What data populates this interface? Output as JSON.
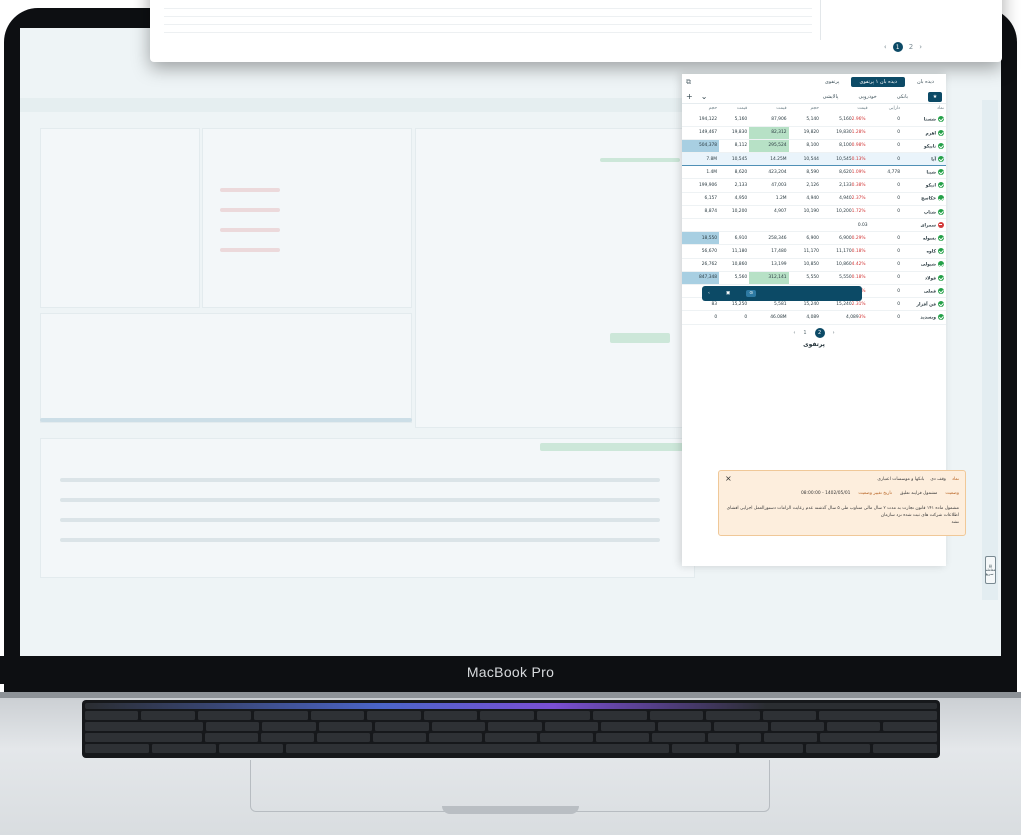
{
  "brand": "MacBook Pro",
  "tabs": [
    "دیده بان",
    "دیده بان ۱ پرتفوی",
    "پرتفوی"
  ],
  "subtabs": [
    "بانکی",
    "خودرویی",
    "پالایشی"
  ],
  "columns": [
    "نماد",
    "دارایی",
    "قیمت",
    "حجم",
    "قیمت",
    "قیمت",
    "حجم"
  ],
  "rows": [
    {
      "name": "شستا",
      "status": "green",
      "asset": "0",
      "price": "5,160",
      "change": "2.96%",
      "vol": "5,140",
      "bid": "87,906",
      "bid_price": "5,160",
      "bid_vol": "194,122"
    },
    {
      "name": "اهرم",
      "status": "green",
      "asset": "0",
      "price": "19,830",
      "change": "1.28%",
      "vol": "19,820",
      "bid": "82,312",
      "bid_price": "19,830",
      "bid_vol": "149,467"
    },
    {
      "name": "تاپیکو",
      "status": "green",
      "asset": "0",
      "price": "8,100",
      "change": "0.98%",
      "vol": "8,100",
      "bid": "295,524",
      "bid_price": "8,112",
      "bid_vol": "504,378"
    },
    {
      "name": "آبا",
      "status": "green",
      "asset": "0",
      "price": "10,545",
      "change": "0.13%",
      "vol": "10,544",
      "bid": "14.25M",
      "bid_price": "10,545",
      "bid_vol": "7.8M"
    },
    {
      "name": "شپنا",
      "status": "green",
      "asset": "4,778",
      "price": "8,620",
      "change": "1.09%",
      "vol": "8,590",
      "bid": "423,204",
      "bid_price": "8,620",
      "bid_vol": "1.4M"
    },
    {
      "name": "انیکو",
      "status": "green",
      "asset": "0",
      "price": "2,133",
      "change": "0.38%",
      "vol": "2,126",
      "bid": "47,003",
      "bid_price": "2,133",
      "bid_vol": "199,906"
    },
    {
      "name": "خکاسچ",
      "status": "green",
      "asset": "0",
      "price": "4,940",
      "change": "2.37%",
      "vol": "4,940",
      "bid": "1.2M",
      "bid_price": "4,950",
      "bid_vol": "6,157"
    },
    {
      "name": "شتاپ",
      "status": "green",
      "asset": "0",
      "price": "10,200",
      "change": "1.72%",
      "vol": "10,190",
      "bid": "4,907",
      "bid_price": "10,200",
      "bid_vol": "8,874"
    },
    {
      "name": "سمرای",
      "status": "red",
      "asset": "",
      "price": "0.03",
      "change": "",
      "vol": "",
      "bid": "",
      "bid_price": "",
      "bid_vol": ""
    },
    {
      "name": "بسوله",
      "status": "green",
      "asset": "0",
      "price": "6,900",
      "change": "0.29%",
      "vol": "6,900",
      "bid": "258,346",
      "bid_price": "6,910",
      "bid_vol": "18,550"
    },
    {
      "name": "کاوه",
      "status": "green",
      "asset": "0",
      "price": "11,170",
      "change": "0.18%",
      "vol": "11,170",
      "bid": "17,480",
      "bid_price": "11,180",
      "bid_vol": "56,670"
    },
    {
      "name": "شپولی",
      "status": "green",
      "asset": "0",
      "price": "10,860",
      "change": "4.42%",
      "vol": "10,850",
      "bid": "13,199",
      "bid_price": "10,860",
      "bid_vol": "26,762"
    },
    {
      "name": "فولاد",
      "status": "green",
      "asset": "0",
      "price": "5,550",
      "change": "0.18%",
      "vol": "5,550",
      "bid": "312,141",
      "bid_price": "5,560",
      "bid_vol": "847,348"
    },
    {
      "name": "فملی",
      "status": "green",
      "asset": "0",
      "price": "7,390",
      "change": "0.27%",
      "vol": "7,390",
      "bid": "1.93M",
      "bid_price": "7,400",
      "bid_vol": "1.04M"
    },
    {
      "name": "فن آفزار",
      "status": "green",
      "asset": "0",
      "price": "15,240",
      "change": "2.31%",
      "vol": "15,240",
      "bid": "5,581",
      "bid_price": "15,250",
      "bid_vol": "83"
    },
    {
      "name": "وبسدید",
      "status": "green",
      "asset": "0",
      "price": "4,089",
      "change": "3%",
      "vol": "4,089",
      "bid": "46.08M",
      "bid_price": "0",
      "bid_vol": "0"
    }
  ],
  "pager": [
    "1",
    "2"
  ],
  "portfolio_title": "پرتفوی",
  "alert": {
    "r1": [
      "نماد",
      "وقف دی",
      "بانکها و موسسات اعتباری"
    ],
    "status_label": "وضعیت",
    "status_value": "مشمول فرایند تعلیق",
    "date_label": "تاریخ تغییر وضعیت",
    "date_value": "1402/05/01 - 08:00:00",
    "desc": "مشمول ماده ۱۴۱ قانون تجارت به مدت ۲ سال مالی متناوب طی ۵ سال گذشته عدم رعایت الزامات دستورالعمل اجرایی افشای اطلاعات شرکت های ثبت شده نزد سازمان",
    "extra": "نشد"
  },
  "side_button": "معامله سریع"
}
